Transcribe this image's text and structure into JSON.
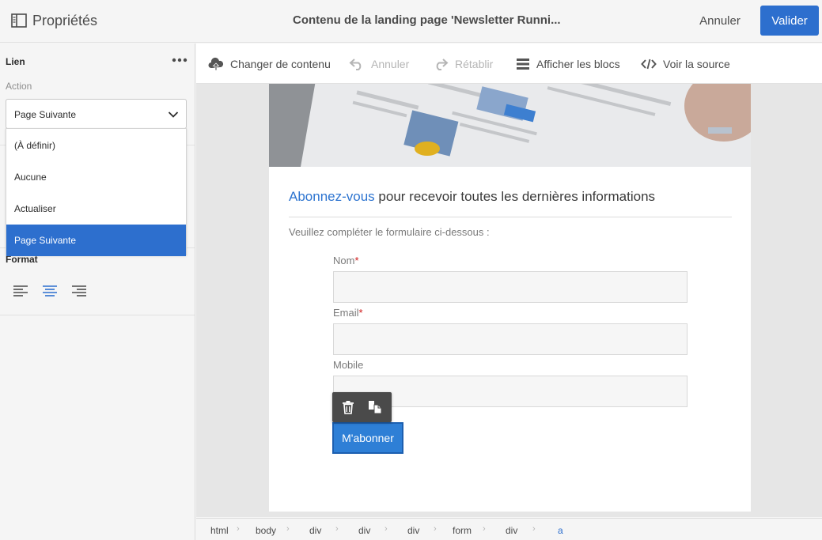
{
  "header": {
    "panel_title": "Propriétés",
    "document_title": "Contenu de la landing page 'Newsletter Runni...",
    "cancel_label": "Annuler",
    "validate_label": "Valider"
  },
  "properties": {
    "section_title": "Lien",
    "action_label": "Action",
    "action_selected": "Page Suivante",
    "action_options": [
      "(À définir)",
      "Aucune",
      "Actualiser",
      "Page Suivante"
    ],
    "format_label": "Format",
    "alignment_active": "center"
  },
  "toolbar": {
    "change_content": "Changer de contenu",
    "undo": "Annuler",
    "redo": "Rétablir",
    "show_blocks": "Afficher les blocs",
    "view_source": "Voir la source"
  },
  "content": {
    "headline_link": "Abonnez-vous",
    "headline_rest": " pour recevoir toutes les dernières informations",
    "subtext": "Veuillez compléter le formulaire ci-dessous :",
    "fields": [
      {
        "label": "Nom",
        "required": true
      },
      {
        "label": "Email",
        "required": true
      },
      {
        "label": "Mobile",
        "required": false
      }
    ],
    "required_mark": "*",
    "submit_label": "M'abonner"
  },
  "breadcrumb": [
    "html",
    "body",
    "div",
    "div",
    "div",
    "form",
    "div",
    "a"
  ],
  "colors": {
    "accent": "#2d6fce",
    "link": "#2d74d0",
    "required": "#cf1b1b",
    "disabled": "#b5b5b5"
  }
}
